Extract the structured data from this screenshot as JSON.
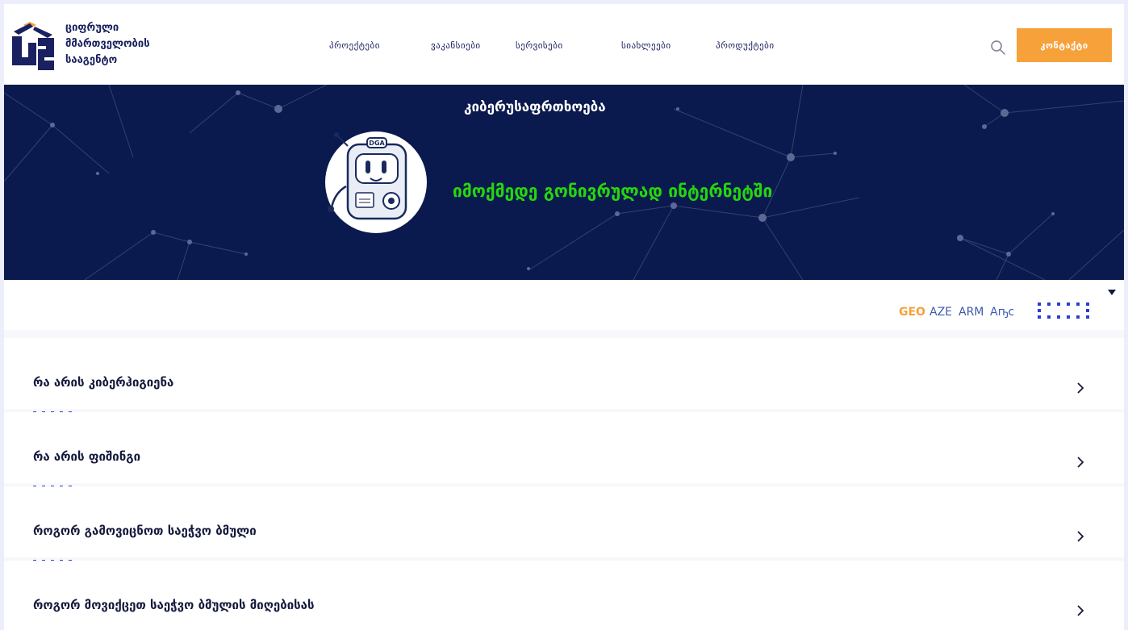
{
  "header": {
    "logo_lines": [
      "ციფრული",
      "მმართველობის",
      "სააგენტო"
    ],
    "nav": [
      "პროექტები",
      "ვაკანსიები",
      "სერვისები",
      "სიახლეები",
      "პროდუქტები"
    ],
    "contact_label": "კონტაქტი",
    "icons": [
      "logo-mark",
      "search-icon"
    ]
  },
  "hero": {
    "title": "კიბერუსაფრთხოება",
    "tagline": "იმოქმედე გონივრულად ინტერნეტში",
    "mascot_text": "DGA",
    "colors": {
      "background": "#0b1a4e",
      "tagline": "#25d60f",
      "title": "#ffffff"
    }
  },
  "languages": {
    "items": [
      "GEO",
      "AZE",
      "ARM",
      "Аҧс"
    ],
    "selected": "GEO",
    "icons": [
      "dots-grid-icon",
      "caret-down-icon"
    ]
  },
  "accordion": {
    "items": [
      "რა არის კიბერჰიგიენა",
      "რა არის ფიშინგი",
      "როგორ გამოვიცნოთ საეჭვო ბმული",
      "როგორ მოვიქცეთ საეჭვო ბმულის მიღებისას"
    ],
    "icon": "chevron-right-icon"
  },
  "colors": {
    "accent": "#f7a13b",
    "brand": "#1a2160",
    "link": "#3c5ab0"
  }
}
